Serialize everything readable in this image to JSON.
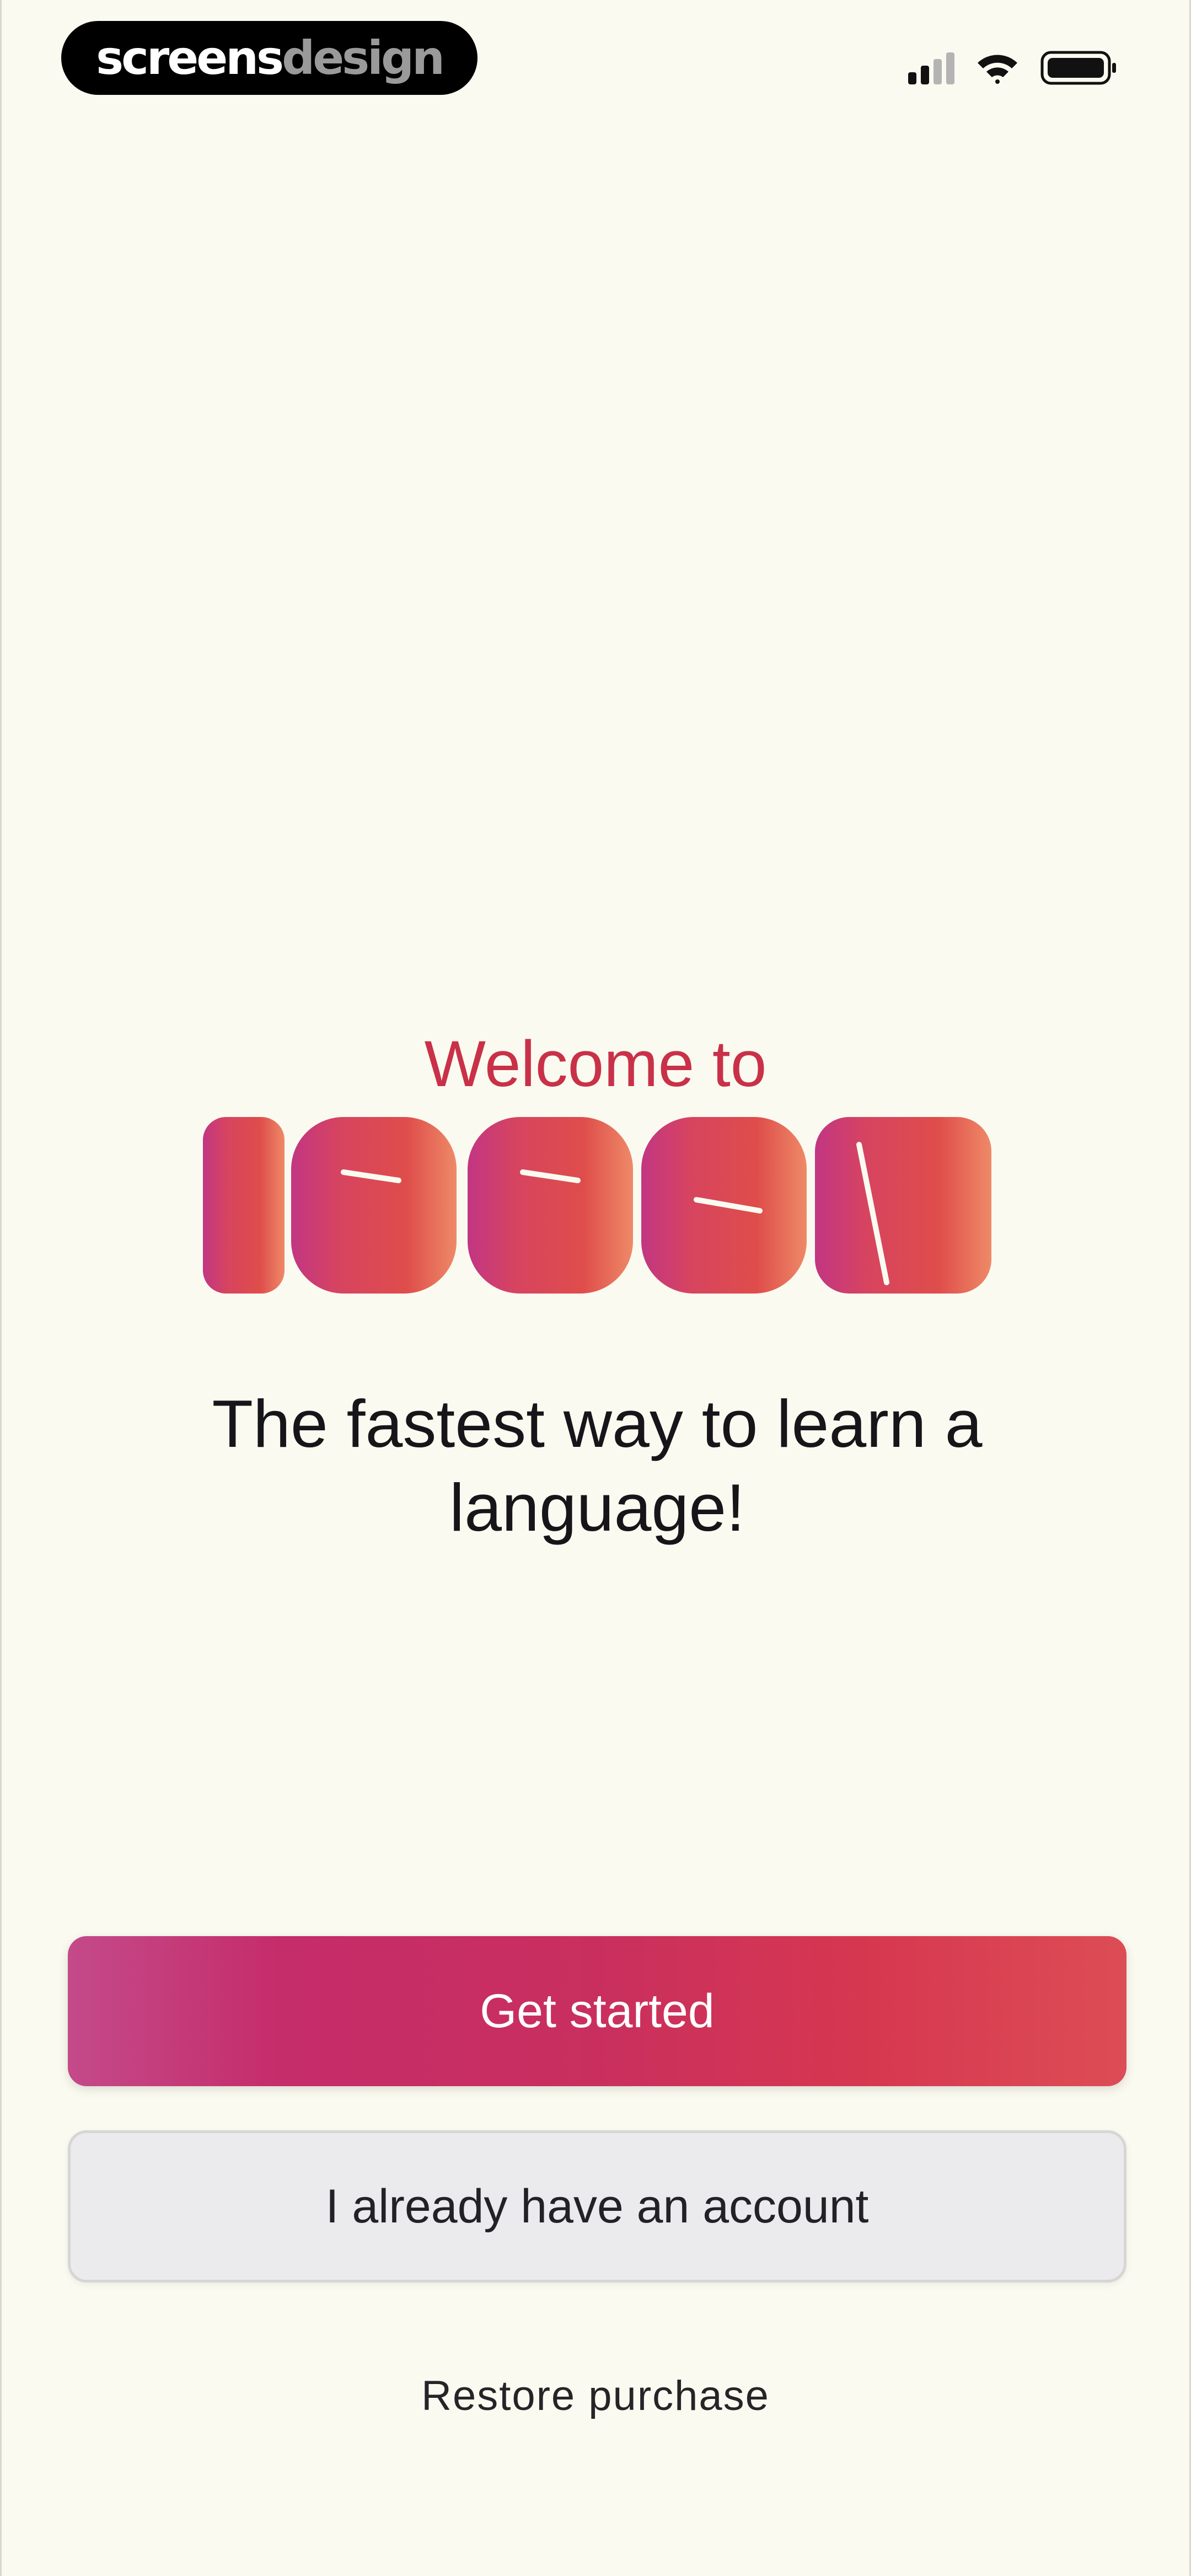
{
  "brand": {
    "part1": "screens",
    "part2": "design"
  },
  "status_bar": {
    "icons": [
      "cellular-signal-icon",
      "wifi-icon",
      "battery-icon"
    ]
  },
  "welcome": {
    "heading": "Welcome to",
    "logo_text": "ISSEN",
    "tagline": "The fastest way to learn a language!"
  },
  "actions": {
    "primary_label": "Get started",
    "secondary_label": "I already have an account",
    "restore_label": "Restore purchase"
  },
  "colors": {
    "background": "#fafaf0",
    "accent": "#c93148",
    "gradient_start": "#c23b7e",
    "gradient_end": "#ef8a62"
  }
}
